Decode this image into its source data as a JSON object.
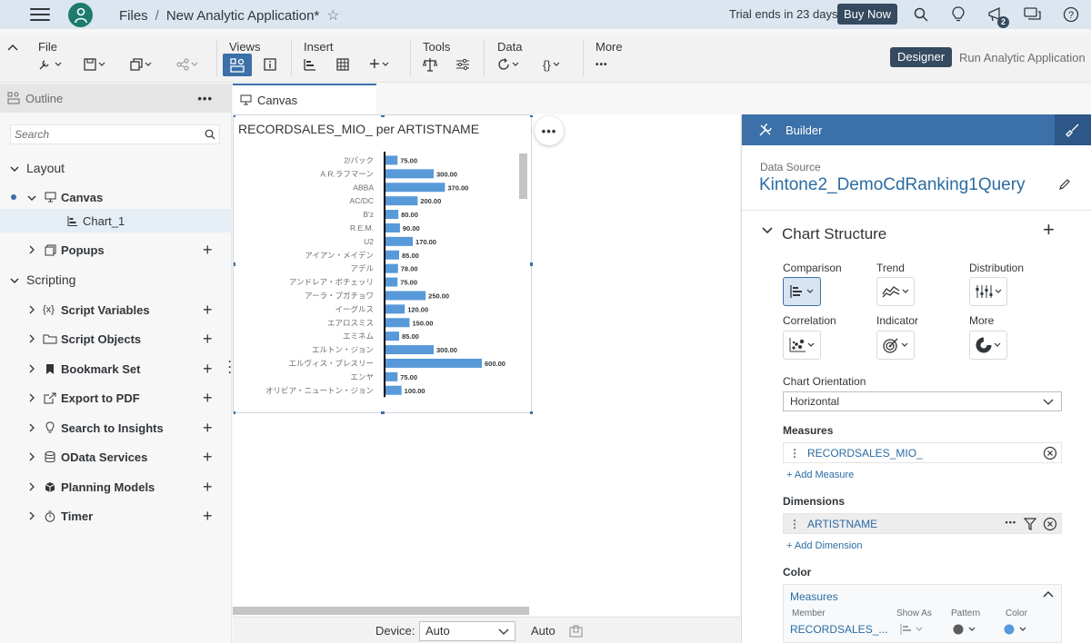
{
  "shell": {
    "breadcrumb_files": "Files",
    "breadcrumb_sep": "/",
    "app_title": "New Analytic Application*",
    "trial_text": "Trial ends in 23 days",
    "buy_now": "Buy Now",
    "notification_count": "2"
  },
  "toolbar": {
    "file": "File",
    "views": "Views",
    "insert": "Insert",
    "tools": "Tools",
    "data": "Data",
    "more": "More",
    "more_dots": "•••",
    "data_braces": "{}",
    "designer": "Designer",
    "run": "Run Analytic Application"
  },
  "outline": {
    "title": "Outline",
    "dots": "•••",
    "search_placeholder": "Search",
    "layout": "Layout",
    "canvas": "Canvas",
    "chart": "Chart_1",
    "popups": "Popups",
    "scripting": "Scripting",
    "items": [
      "Script Variables",
      "Script Objects",
      "Bookmark Set",
      "Export to PDF",
      "Search to Insights",
      "OData Services",
      "Planning Models",
      "Timer"
    ]
  },
  "canvas": {
    "tab_label": "Canvas",
    "more_dots": "•••",
    "device_label": "Device:",
    "device_value": "Auto",
    "device_auto": "Auto"
  },
  "chart_data": {
    "type": "bar",
    "orientation": "horizontal",
    "title": "RECORDSALES_MIO_ per ARTISTNAME",
    "categories": [
      "2/パック",
      "A.R.ラフマーン",
      "ABBA",
      "AC/DC",
      "B'z",
      "R.E.M.",
      "U2",
      "アイアン・メイデン",
      "アデル",
      "アンドレア・ボチェッリ",
      "アーラ・プガチョワ",
      "イーグルス",
      "エアロスミス",
      "エミネム",
      "エルトン・ジョン",
      "エルヴィス・プレスリー",
      "エンヤ",
      "オリビア・ニュートン・ジョン"
    ],
    "values": [
      75,
      300,
      370,
      200,
      80,
      90,
      170,
      85,
      78,
      75,
      250,
      120,
      150,
      85,
      300,
      600,
      75,
      100
    ],
    "value_labels": [
      "75.00",
      "300.00",
      "370.00",
      "200.00",
      "80.00",
      "90.00",
      "170.00",
      "85.00",
      "78.00",
      "75.00",
      "250.00",
      "120.00",
      "150.00",
      "85.00",
      "300.00",
      "600.00",
      "75.00",
      "100.00"
    ],
    "bar_color": "#5899da",
    "xlim": [
      0,
      600
    ]
  },
  "builder": {
    "title": "Builder",
    "data_source_label": "Data Source",
    "data_source": "Kintone2_DemoCdRanking1Query",
    "chart_structure": "Chart Structure",
    "types": [
      "Comparison",
      "Trend",
      "Distribution",
      "Correlation",
      "Indicator",
      "More"
    ],
    "orientation_label": "Chart Orientation",
    "orientation_value": "Horizontal",
    "measures_label": "Measures",
    "measure": "RECORDSALES_MIO_",
    "add_measure": "+ Add Measure",
    "dimensions_label": "Dimensions",
    "dimension": "ARTISTNAME",
    "dimension_dots": "•••",
    "add_dimension": "+ Add Dimension",
    "color_label": "Color",
    "color_measures": "Measures",
    "col_member": "Member",
    "col_show_as": "Show As",
    "col_pattern": "Pattern",
    "col_color": "Color",
    "member_value": "RECORDSALES_..."
  },
  "colors": {
    "accent": "#3b70a8",
    "shell_bg": "#dbe6f0",
    "dark_button": "#354a5f",
    "bar": "#5899da"
  }
}
